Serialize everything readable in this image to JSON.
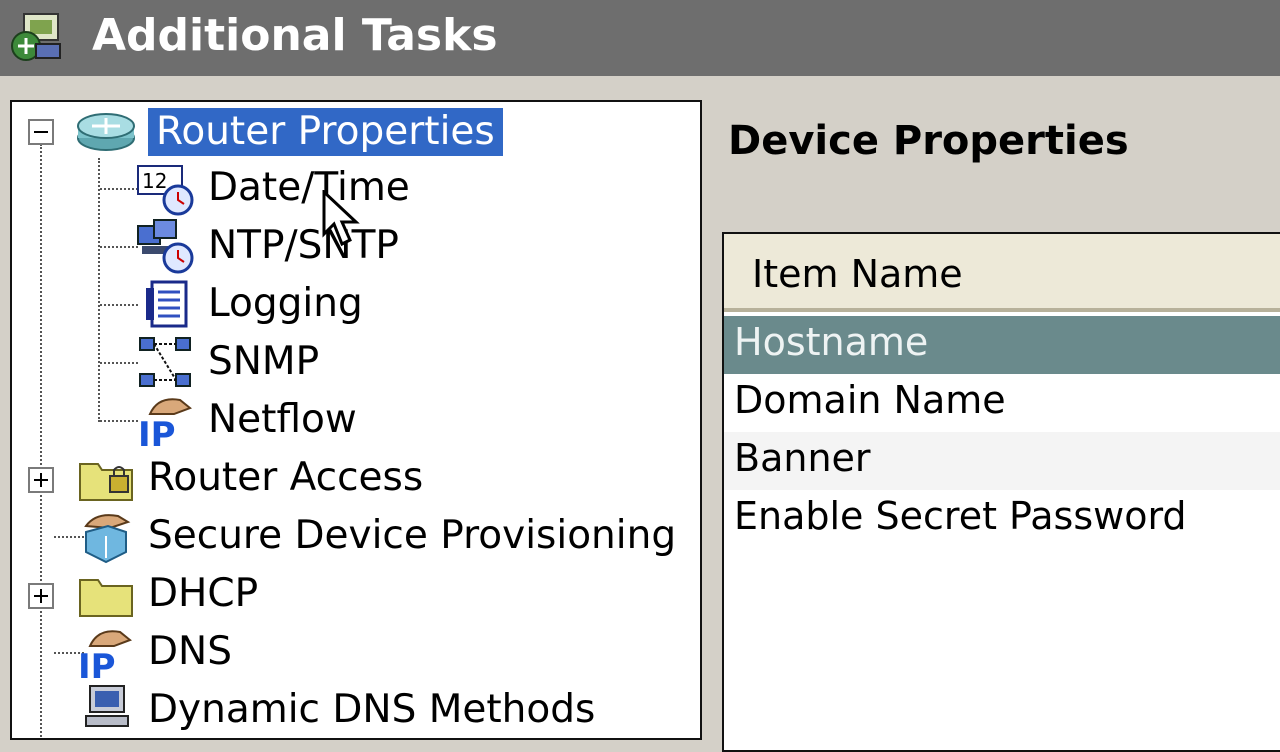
{
  "window": {
    "title": "Additional Tasks",
    "title_icon": "additional-tasks-icon"
  },
  "tree": {
    "items": [
      {
        "label": "Router Properties",
        "icon": "router-icon",
        "expanded": true,
        "selected": true
      },
      {
        "label": "Date/Time",
        "icon": "date-time-icon"
      },
      {
        "label": "NTP/SNTP",
        "icon": "ntp-icon"
      },
      {
        "label": "Logging",
        "icon": "logging-icon"
      },
      {
        "label": "SNMP",
        "icon": "snmp-icon"
      },
      {
        "label": "Netflow",
        "icon": "ip-hand-icon"
      },
      {
        "label": "Router Access",
        "icon": "folder-lock-icon",
        "expanded": false
      },
      {
        "label": "Secure Device Provisioning",
        "icon": "secure-provisioning-icon"
      },
      {
        "label": "DHCP",
        "icon": "folder-icon",
        "expanded": false
      },
      {
        "label": "DNS",
        "icon": "ip-hand-icon"
      },
      {
        "label": "Dynamic DNS Methods",
        "icon": "computer-icon"
      }
    ]
  },
  "details": {
    "title": "Device Properties",
    "column_header": "Item Name",
    "rows": [
      "Hostname",
      "Domain Name",
      "Banner",
      "Enable Secret Password"
    ],
    "selected_row": "Hostname"
  },
  "colors": {
    "titlebar": "#6e6e6e",
    "tree_selection": "#3168c6",
    "table_selection": "#6a8a8c",
    "table_header": "#ede9d8"
  }
}
